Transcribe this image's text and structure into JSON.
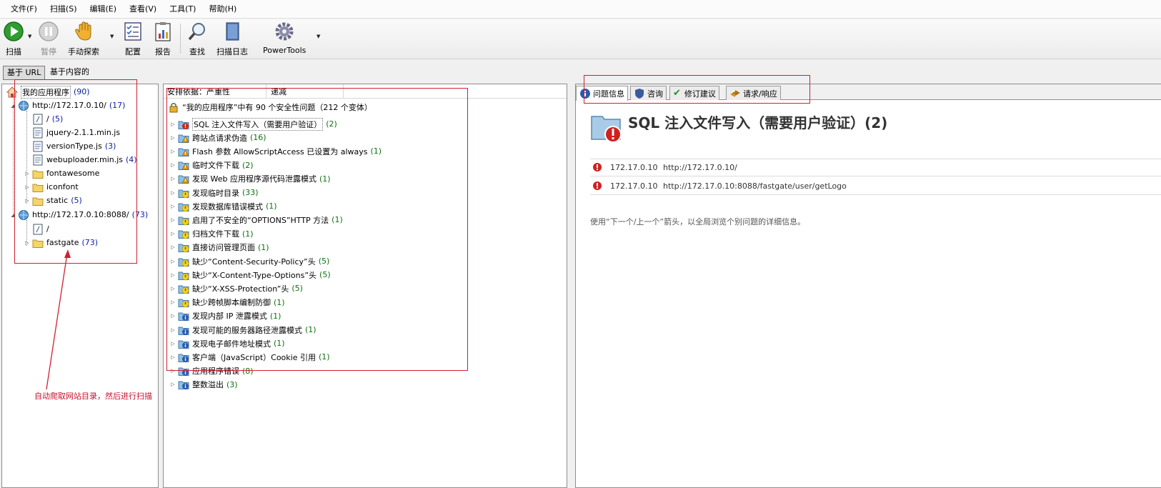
{
  "menu": [
    "文件(F)",
    "扫描(S)",
    "编辑(E)",
    "查看(V)",
    "工具(T)",
    "帮助(H)"
  ],
  "toolbar": {
    "scan": "扫描",
    "pause": "暂停",
    "manual": "手动探索",
    "config": "配置",
    "report": "报告",
    "find": "查找",
    "log": "扫描日志",
    "powertools": "PowerTools"
  },
  "view_tabs": [
    "基于 URL",
    "基于内容的"
  ],
  "tree": {
    "root": {
      "label": "我的应用程序",
      "count": "(90)"
    },
    "hosts": [
      {
        "label": "http://172.17.0.10/",
        "count": "(17)"
      },
      {
        "label": "http://172.17.0.10:8088/",
        "count": "(73)"
      }
    ],
    "host1_children": [
      {
        "label": "/",
        "count": "(5)"
      },
      {
        "label": "jquery-2.1.1.min.js",
        "count": ""
      },
      {
        "label": "versionType.js",
        "count": "(3)"
      },
      {
        "label": "webuploader.min.js",
        "count": "(4)"
      },
      {
        "label": "fontawesome",
        "count": ""
      },
      {
        "label": "iconfont",
        "count": ""
      },
      {
        "label": "static",
        "count": "(5)"
      }
    ],
    "host2_children": [
      {
        "label": "/",
        "count": ""
      },
      {
        "label": "fastgate",
        "count": "(73)"
      }
    ]
  },
  "mid": {
    "sort_label": "安排依据：严重性",
    "sort_order": "递减",
    "summary": "“我的应用程序”中有 90 个安全性问题（212 个变体）",
    "issues": [
      {
        "label": "SQL 注入文件写入（需要用户验证）",
        "count": "(2)",
        "sev": "high"
      },
      {
        "label": "跨站点请求伪造",
        "count": "(16)",
        "sev": "medium"
      },
      {
        "label": "Flash 参数 AllowScriptAccess 已设置为 always",
        "count": "(1)",
        "sev": "medium"
      },
      {
        "label": "临时文件下载",
        "count": "(2)",
        "sev": "medium"
      },
      {
        "label": "发现 Web 应用程序源代码泄露模式",
        "count": "(1)",
        "sev": "medium"
      },
      {
        "label": "发现临时目录",
        "count": "(33)",
        "sev": "low"
      },
      {
        "label": "发现数据库错误模式",
        "count": "(1)",
        "sev": "low"
      },
      {
        "label": "启用了不安全的“OPTIONS”HTTP 方法",
        "count": "(1)",
        "sev": "low"
      },
      {
        "label": "归档文件下载",
        "count": "(1)",
        "sev": "low"
      },
      {
        "label": "直接访问管理页面",
        "count": "(1)",
        "sev": "low"
      },
      {
        "label": "缺少“Content-Security-Policy”头",
        "count": "(5)",
        "sev": "low"
      },
      {
        "label": "缺少“X-Content-Type-Options”头",
        "count": "(5)",
        "sev": "low"
      },
      {
        "label": "缺少“X-XSS-Protection”头",
        "count": "(5)",
        "sev": "low"
      },
      {
        "label": "缺少跨帧脚本编制防御",
        "count": "(1)",
        "sev": "low"
      },
      {
        "label": "发现内部 IP 泄露模式",
        "count": "(1)",
        "sev": "info"
      },
      {
        "label": "发现可能的服务器路径泄露模式",
        "count": "(1)",
        "sev": "info"
      },
      {
        "label": "发现电子邮件地址模式",
        "count": "(1)",
        "sev": "info"
      },
      {
        "label": "客户端（JavaScript）Cookie 引用",
        "count": "(1)",
        "sev": "info"
      },
      {
        "label": "应用程序错误",
        "count": "(8)",
        "sev": "info"
      },
      {
        "label": "整数溢出",
        "count": "(3)",
        "sev": "info"
      }
    ]
  },
  "detail": {
    "tabs": [
      "问题信息",
      "咨询",
      "修订建议",
      "请求/响应"
    ],
    "title": "SQL 注入文件写入（需要用户验证）(2)",
    "rows": [
      {
        "ip": "172.17.0.10",
        "url": "http://172.17.0.10/"
      },
      {
        "ip": "172.17.0.10",
        "url": "http://172.17.0.10:8088/fastgate/user/getLogo"
      }
    ],
    "hint": "使用“下一个/上一个”箭头，以全局浏览个别问题的详细信息。"
  },
  "annotation": "自动爬取网站目录，然后进行扫描",
  "colors": {
    "accent_red": "#d02030",
    "count_blue": "#0b1fa6",
    "count_green": "#107010"
  }
}
